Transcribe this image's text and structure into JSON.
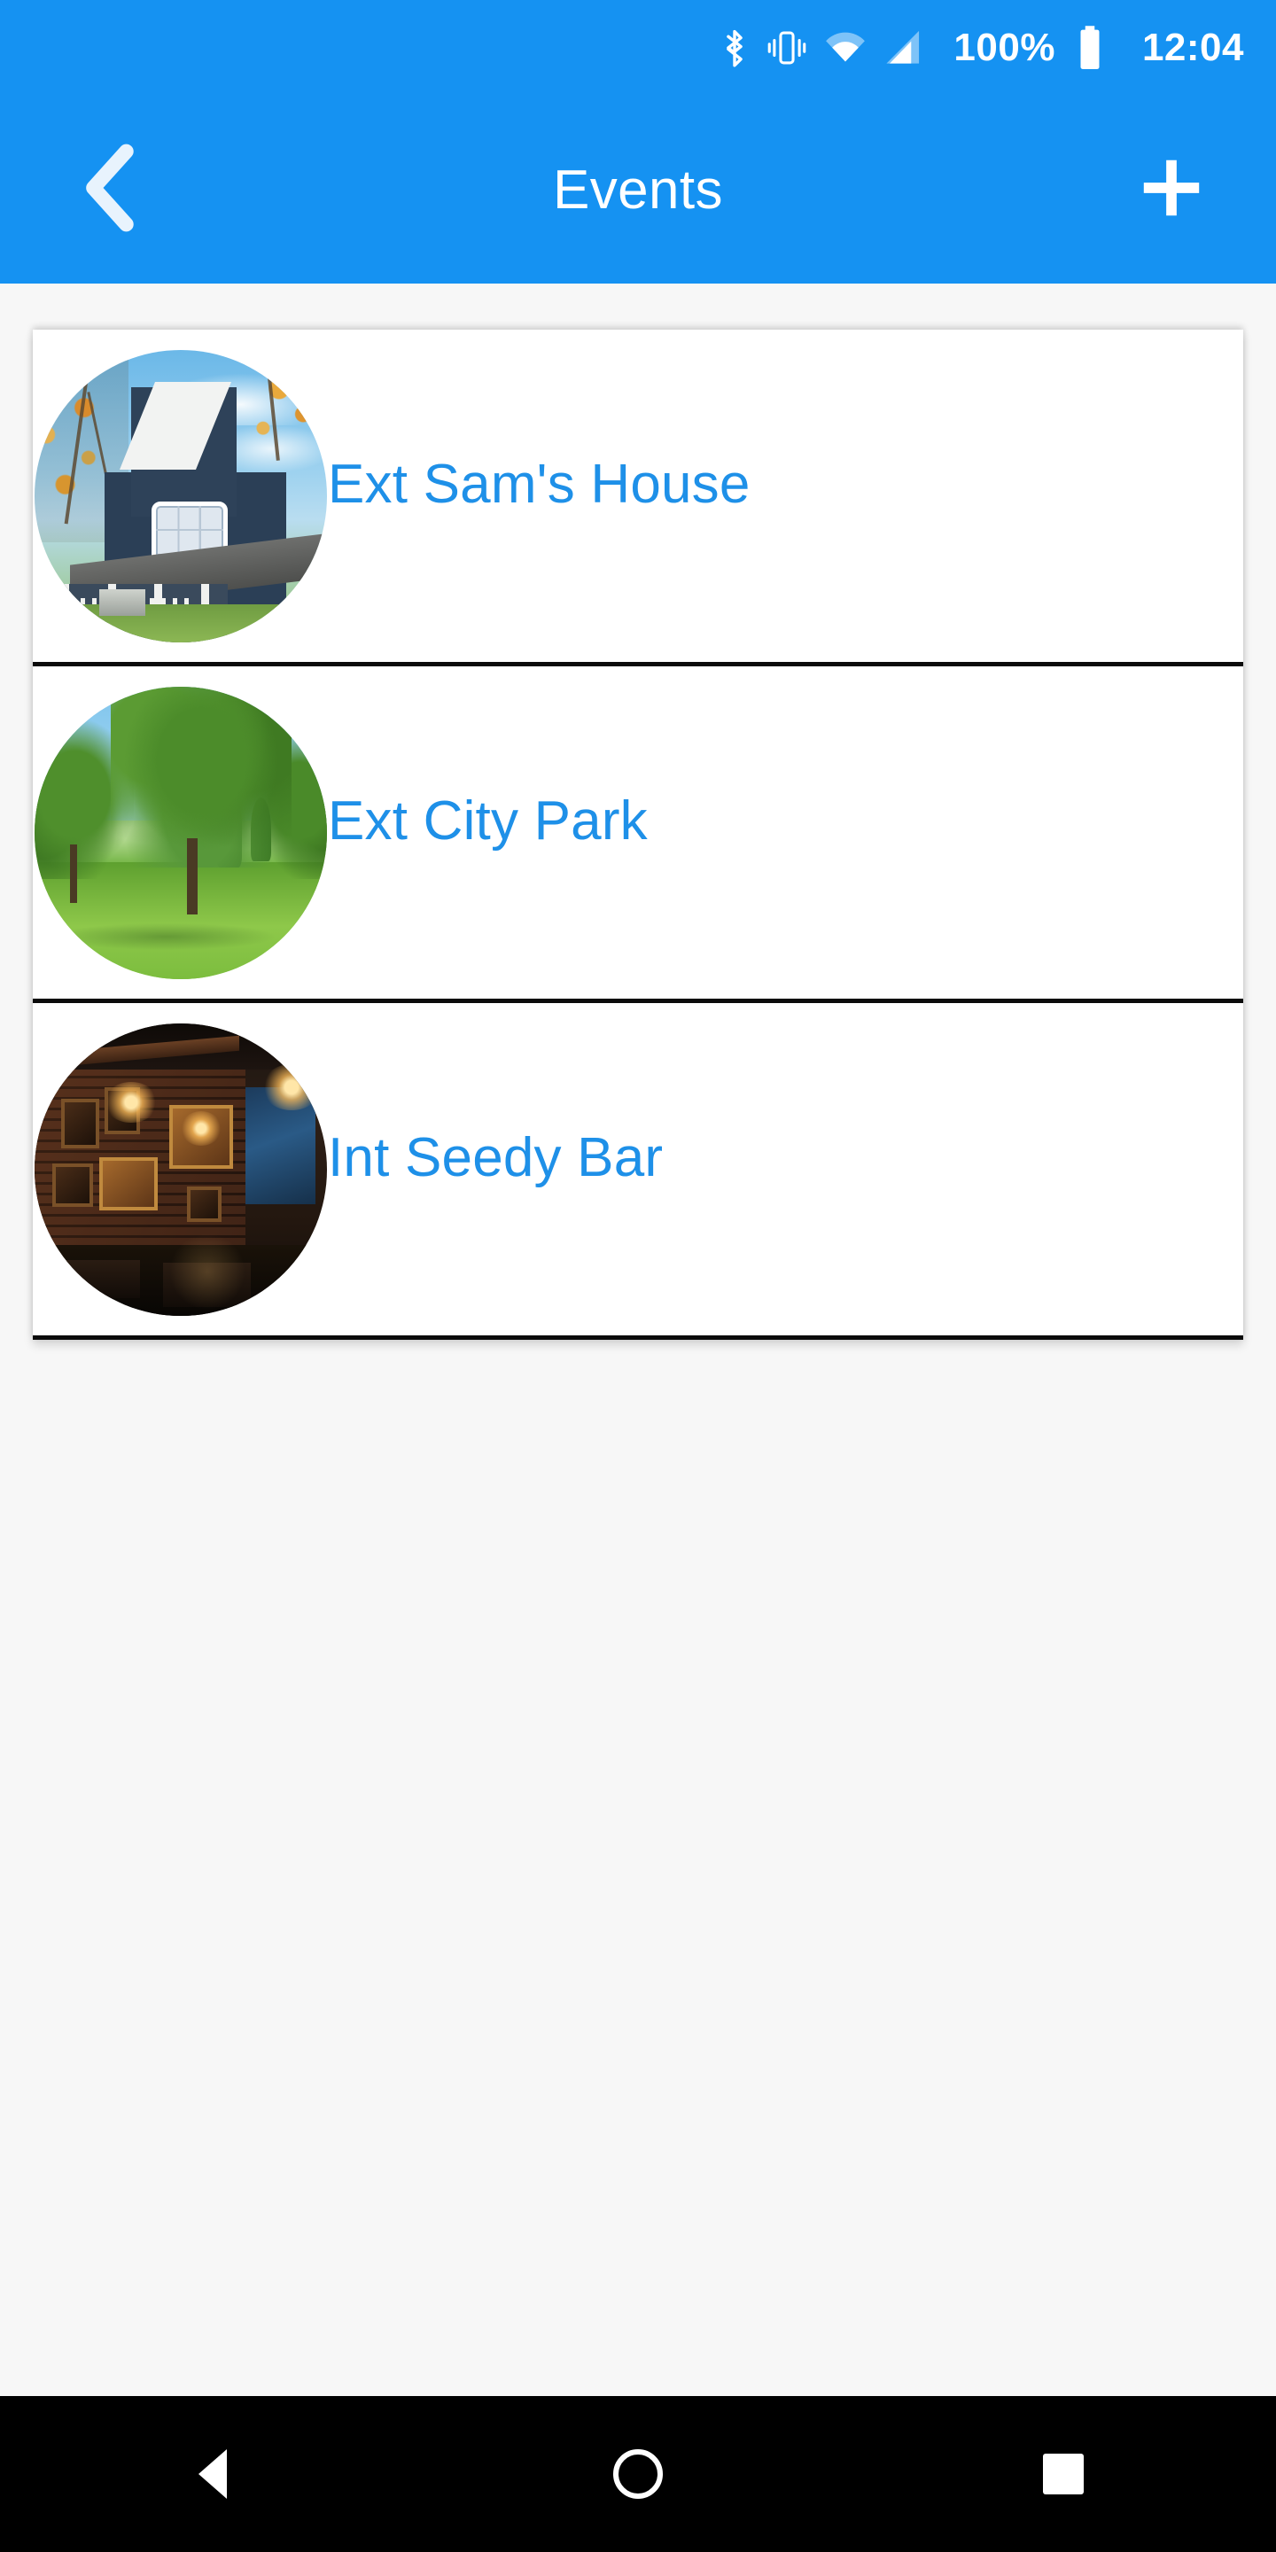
{
  "status_bar": {
    "battery_percent": "100%",
    "clock": "12:04",
    "icons": [
      "bluetooth-icon",
      "vibrate-icon",
      "wifi-icon",
      "cellular-signal-icon",
      "battery-icon"
    ],
    "background_color": "#1592f2",
    "foreground_color": "#ffffff"
  },
  "app_bar": {
    "title": "Events",
    "back_icon": "chevron-left-icon",
    "add_icon": "plus-icon",
    "background_color": "#1592f2",
    "title_color": "#ffffff"
  },
  "list": {
    "accent_color": "#1e90e8",
    "card_background": "#ffffff",
    "divider_color": "#0b0b0b",
    "items": [
      {
        "label": "Ext Sam's House",
        "thumbnail": "house-exterior-photo",
        "thumbnail_description": "Navy blue two-story house with white trim, gabled dormer, porch, autumn trees and blue sky"
      },
      {
        "label": "Ext City Park",
        "thumbnail": "city-park-photo",
        "thumbnail_description": "Green park lawn with large willow trees and clear blue sky"
      },
      {
        "label": "Int Seedy Bar",
        "thumbnail": "bar-interior-photo",
        "thumbnail_description": "Dim bar interior with brick walls, framed pictures and warm amber lights"
      }
    ]
  },
  "nav_bar": {
    "back_label": "back-triangle-icon",
    "home_label": "home-circle-icon",
    "recents_label": "recents-square-icon",
    "background_color": "#000000"
  }
}
